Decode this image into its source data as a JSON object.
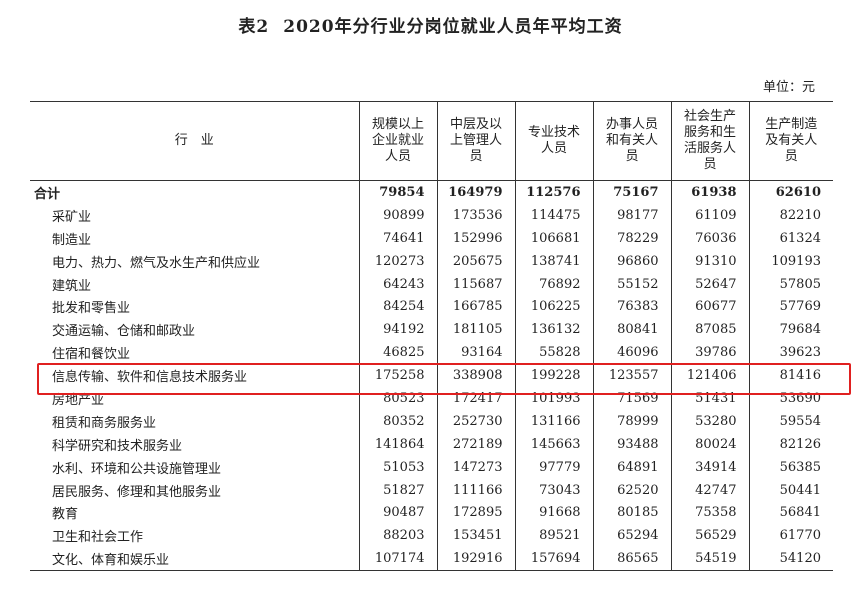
{
  "title": {
    "number": "表2",
    "text": "2020年分行业分岗位就业人员年平均工资"
  },
  "unit": "单位：元",
  "columns": [
    {
      "lines": [
        "行　业"
      ]
    },
    {
      "lines": [
        "规模以上",
        "企业就业",
        "人员"
      ]
    },
    {
      "lines": [
        "中层及以",
        "上管理人",
        "员"
      ]
    },
    {
      "lines": [
        "专业技术",
        "人员"
      ]
    },
    {
      "lines": [
        "办事人员",
        "和有关人",
        "员"
      ]
    },
    {
      "lines": [
        "社会生产",
        "服务和生",
        "活服务人",
        "员"
      ]
    },
    {
      "lines": [
        "生产制造",
        "及有关人",
        "员"
      ]
    }
  ],
  "rows": [
    {
      "name": "合计",
      "values": [
        "79854",
        "164979",
        "112576",
        "75167",
        "61938",
        "62610"
      ]
    },
    {
      "name": "采矿业",
      "values": [
        "90899",
        "173536",
        "114475",
        "98177",
        "61109",
        "82210"
      ]
    },
    {
      "name": "制造业",
      "values": [
        "74641",
        "152996",
        "106681",
        "78229",
        "76036",
        "61324"
      ]
    },
    {
      "name": "电力、热力、燃气及水生产和供应业",
      "values": [
        "120273",
        "205675",
        "138741",
        "96860",
        "91310",
        "109193"
      ]
    },
    {
      "name": "建筑业",
      "values": [
        "64243",
        "115687",
        "76892",
        "55152",
        "52647",
        "57805"
      ]
    },
    {
      "name": "批发和零售业",
      "values": [
        "84254",
        "166785",
        "106225",
        "76383",
        "60677",
        "57769"
      ]
    },
    {
      "name": "交通运输、仓储和邮政业",
      "values": [
        "94192",
        "181105",
        "136132",
        "80841",
        "87085",
        "79684"
      ]
    },
    {
      "name": "住宿和餐饮业",
      "values": [
        "46825",
        "93164",
        "55828",
        "46096",
        "39786",
        "39623"
      ]
    },
    {
      "name": "信息传输、软件和信息技术服务业",
      "values": [
        "175258",
        "338908",
        "199228",
        "123557",
        "121406",
        "81416"
      ]
    },
    {
      "name": "房地产业",
      "values": [
        "80523",
        "172417",
        "101993",
        "71569",
        "51431",
        "53690"
      ]
    },
    {
      "name": "租赁和商务服务业",
      "values": [
        "80352",
        "252730",
        "131166",
        "78999",
        "53280",
        "59554"
      ]
    },
    {
      "name": "科学研究和技术服务业",
      "values": [
        "141864",
        "272189",
        "145663",
        "93488",
        "80024",
        "82126"
      ]
    },
    {
      "name": "水利、环境和公共设施管理业",
      "values": [
        "51053",
        "147273",
        "97779",
        "64891",
        "34914",
        "56385"
      ]
    },
    {
      "name": "居民服务、修理和其他服务业",
      "values": [
        "51827",
        "111166",
        "73043",
        "62520",
        "42747",
        "50441"
      ]
    },
    {
      "name": "教育",
      "values": [
        "90487",
        "172895",
        "91668",
        "80185",
        "75358",
        "56841"
      ]
    },
    {
      "name": "卫生和社会工作",
      "values": [
        "88203",
        "153451",
        "89521",
        "65294",
        "56529",
        "61770"
      ]
    },
    {
      "name": "文化、体育和娱乐业",
      "values": [
        "107174",
        "192916",
        "157694",
        "86565",
        "54519",
        "54120"
      ]
    }
  ],
  "highlight": {
    "row_index": 8,
    "color": "#e02020"
  }
}
